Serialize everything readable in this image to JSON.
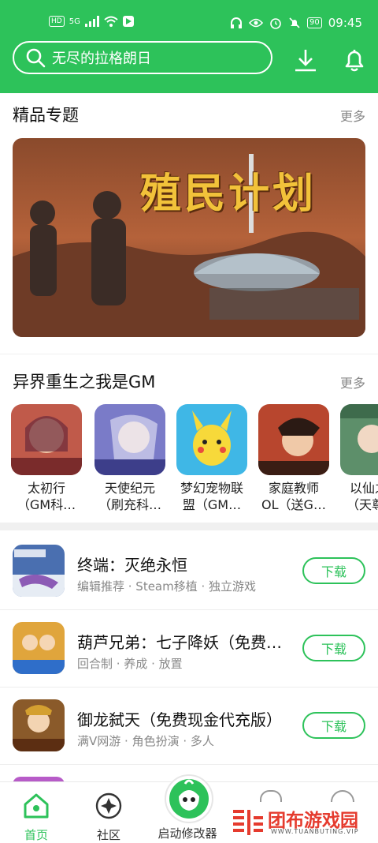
{
  "status_bar": {
    "left_badge": "HD",
    "network": "5G",
    "battery": "90",
    "time": "09:45"
  },
  "search": {
    "placeholder": "无尽的拉格朗日"
  },
  "featured": {
    "title": "精品专题",
    "more": "更多",
    "banner_text": "殖民计划"
  },
  "collection": {
    "title": "异界重生之我是GM",
    "more": "更多",
    "games": [
      {
        "line1": "太初行",
        "line2": "（GM科…",
        "color": "#c05a4a"
      },
      {
        "line1": "天使纪元",
        "line2": "（刷充科…",
        "color": "#7a7bc8"
      },
      {
        "line1": "梦幻宠物联",
        "line2": "盟（GM…",
        "color": "#3fb7e6"
      },
      {
        "line1": "家庭教师",
        "line2": "OL（送G…",
        "color": "#b8462e"
      },
      {
        "line1": "以仙之",
        "line2": "（天尊…",
        "color": "#5d8f6a"
      }
    ]
  },
  "list": [
    {
      "title": "终端：灭绝永恒",
      "tags": "编辑推荐 · Steam移植 · 独立游戏",
      "button": "下载",
      "color": "#4a6fb0"
    },
    {
      "title": "葫芦兄弟：七子降妖（免费…",
      "tags": "回合制 · 养成 · 放置",
      "button": "下载",
      "color": "#e0a53c"
    },
    {
      "title": "御龙弑天（免费现金代充版）",
      "tags": "满V网游 · 角色扮演 · 多人",
      "button": "下载",
      "color": "#8a5a2a"
    }
  ],
  "tabbar": {
    "home": "首页",
    "community": "社区",
    "launcher": "启动修改器"
  },
  "watermark": {
    "name": "团布游戏园",
    "url": "WWW.TUANBUTING.VIP"
  }
}
